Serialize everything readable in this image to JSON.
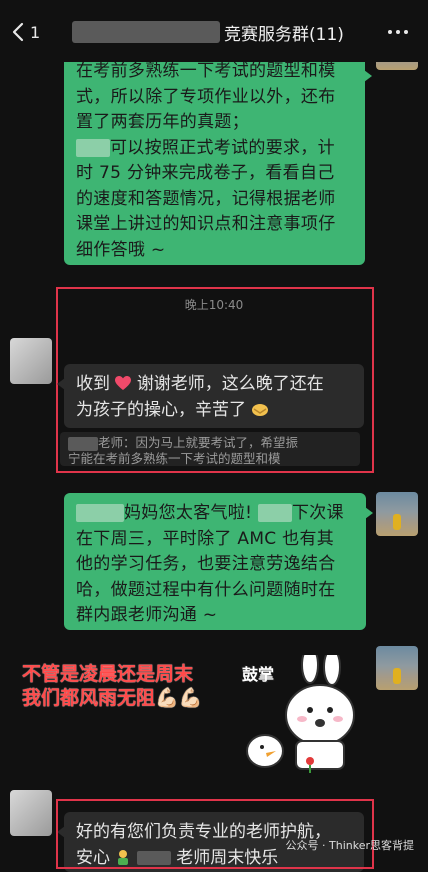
{
  "header": {
    "back_count": "1",
    "title_suffix": "竞赛服务群(11)"
  },
  "messages": {
    "msg1_lines": [
      "在考前多熟练一下考试的题型和模",
      "式，所以除了专项作业以外，还布",
      "置了两套历年的真题；",
      "可以按照正式考试的要求，计",
      "时 75 分钟来完成卷子，看看自己",
      "的速度和答题情况，记得根据老师",
      "课堂上讲过的知识点和注意事项仔",
      "细作答哦 ~"
    ],
    "timestamp": "晚上10:40",
    "msg2_line1_a": "收到",
    "msg2_line1_b": "谢谢老师，这么晚了还在",
    "msg2_line2": "为孩子的操心，辛苦了",
    "quote_line1": "老师：因为马上就要考试了，希望振",
    "quote_line2": "宁能在考前多熟练一下考试的题型和模",
    "msg3_line1_a": "妈妈您太客气啦!",
    "msg3_line1_b": "下次课",
    "msg3_lines": [
      "在下周三，平时除了 AMC 也有其",
      "他的学习任务，也要注意劳逸结合",
      "哈，做题过程中有什么问题随时在",
      "群内跟老师沟通 ~"
    ],
    "msg4_line1": "好的有您们负责专业的老师护航，",
    "msg4_line2_a": "安心",
    "msg4_line2_b": "老师周末快乐"
  },
  "overlay": {
    "caption_line1": "不管是凌晨还是周末",
    "caption_line2": "我们都风雨无阻💪🏻💪🏻",
    "sticker_text": "鼓掌",
    "watermark": "公众号 · Thinker思客背提"
  },
  "colors": {
    "bubble_green": "#3eb573",
    "bubble_dark": "#2b2b2b",
    "highlight_red": "#e0344a",
    "caption_red": "#ff4a4a"
  }
}
